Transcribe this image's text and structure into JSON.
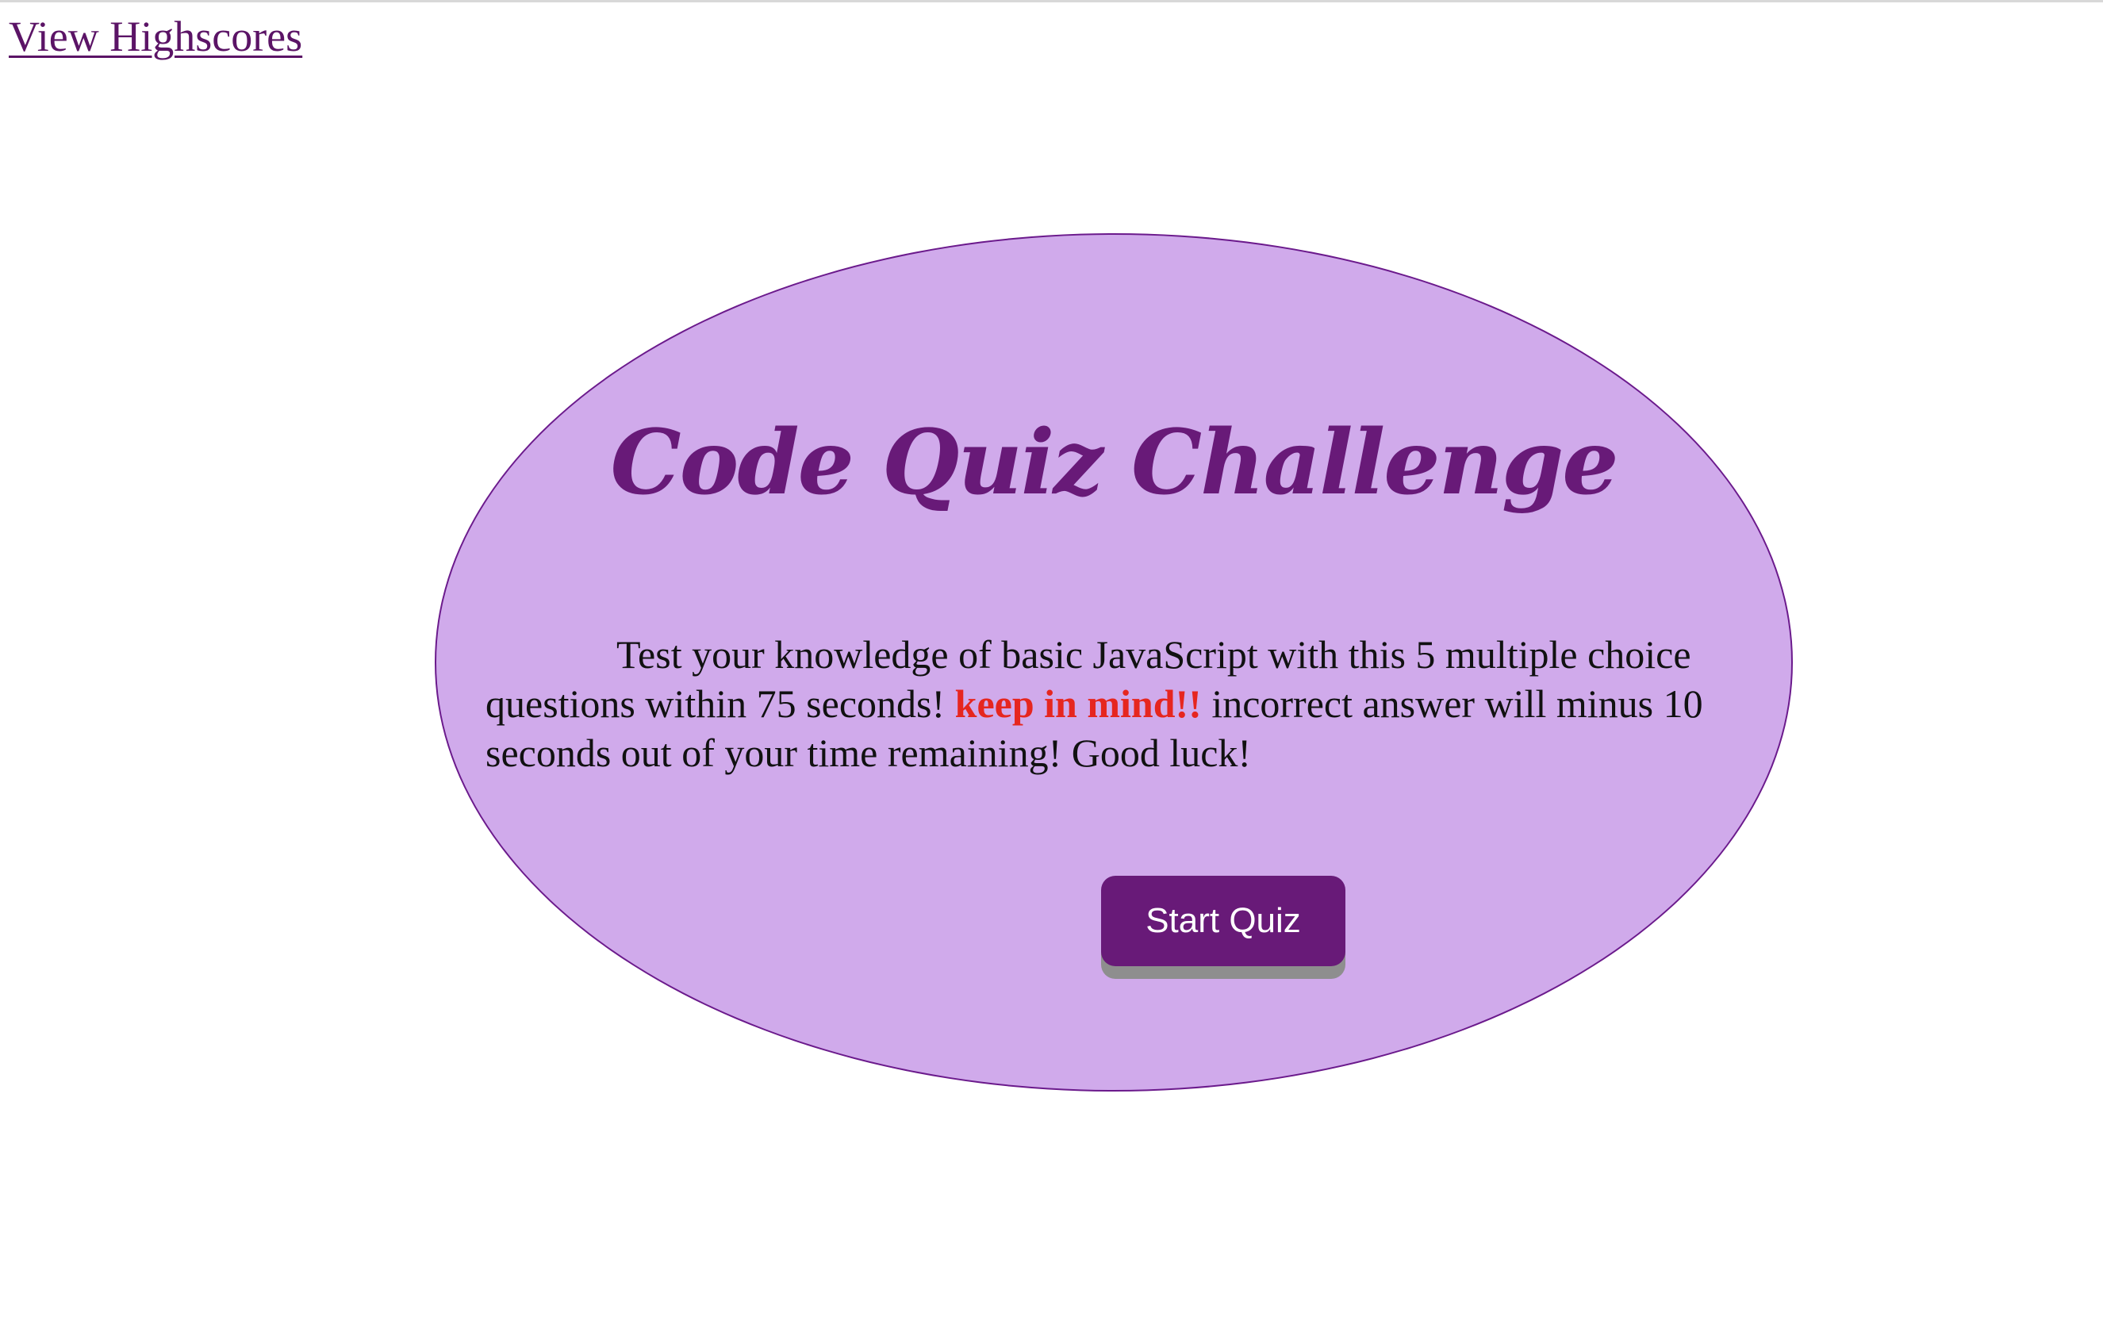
{
  "header": {
    "highscores_label": "View Highscores"
  },
  "card": {
    "title": "Code Quiz Challenge",
    "intro_part1": "Test your knowledge of basic JavaScript with this 5 multiple choice questions within 75 seconds! ",
    "intro_warning": "keep in mind!!",
    "intro_part2": " incorrect answer will minus 10 seconds out of your time remaining! Good luck!",
    "start_button_label": "Start Quiz"
  },
  "colors": {
    "card_background": "#d0aaeb",
    "card_border": "#6b1a8c",
    "title": "#681a78",
    "link": "#5b1466",
    "warning": "#e6261f",
    "button_background": "#681a78",
    "button_text": "#ffffff",
    "button_shadow": "#8e8e8e"
  }
}
